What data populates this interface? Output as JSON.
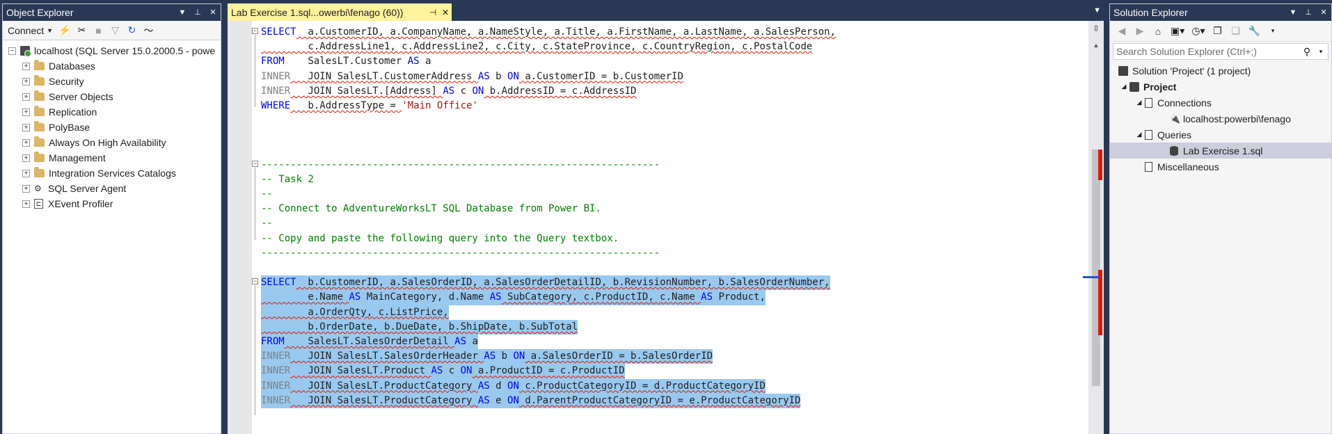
{
  "object_explorer": {
    "title": "Object Explorer",
    "toolbar": {
      "connect_label": "Connect"
    },
    "server_label": "localhost (SQL Server 15.0.2000.5 - powe",
    "nodes": [
      {
        "label": "Databases"
      },
      {
        "label": "Security"
      },
      {
        "label": "Server Objects"
      },
      {
        "label": "Replication"
      },
      {
        "label": "PolyBase"
      },
      {
        "label": "Always On High Availability"
      },
      {
        "label": "Management"
      },
      {
        "label": "Integration Services Catalogs"
      },
      {
        "label": "SQL Server Agent"
      },
      {
        "label": "XEvent Profiler"
      }
    ]
  },
  "editor": {
    "tab_title": "Lab Exercise 1.sql...owerbi\\fenago (60))",
    "code": {
      "l1": {
        "kw": "SELECT",
        "rest": "  a.CustomerID, a.CompanyName, a.NameStyle, a.Title, a.FirstName, a.LastName, a.SalesPerson,"
      },
      "l2": {
        "rest": "        c.AddressLine1, c.AddressLine2, c.City, c.StateProvince, c.CountryRegion, c.PostalCode"
      },
      "l3": {
        "kw": "FROM",
        "rest": "    SalesLT.Customer ",
        "kw2": "AS",
        "rest2": " a"
      },
      "l4": {
        "inner": "INNER",
        "rest": "   JOIN SalesLT.CustomerAddress ",
        "kw2": "AS",
        "rest2": " b ",
        "kw3": "ON",
        "rest3": " a.CustomerID = b.CustomerID"
      },
      "l5": {
        "inner": "INNER",
        "rest": "   JOIN SalesLT.[Address] ",
        "kw2": "AS",
        "rest2": " c ",
        "kw3": "ON",
        "rest3": " b.AddressID = c.AddressID"
      },
      "l6": {
        "kw": "WHERE",
        "rest": "   b.AddressType = ",
        "str": "'Main Office'"
      },
      "c1": "--------------------------------------------------------------------",
      "c2": "-- Task 2",
      "c3": "--",
      "c4": "-- Connect to AdventureWorksLT SQL Database from Power BI.",
      "c5": "--",
      "c6": "-- Copy and paste the following query into the Query textbox.",
      "c7": "--------------------------------------------------------------------",
      "q1": {
        "kw": "SELECT",
        "rest": "  b.CustomerID, a.SalesOrderID, a.SalesOrderDetailID, b.RevisionNumber, b.SalesOrderNumber,"
      },
      "q2": {
        "rest": "        e.Name ",
        "kw2": "AS",
        "rest2": " MainCategory, d.Name ",
        "kw3": "AS",
        "rest3": " SubCategory, c.ProductID, c.Name ",
        "kw4": "AS",
        "rest4": " Product,"
      },
      "q3": {
        "rest": "        a.OrderQty, c.ListPrice,"
      },
      "q4": {
        "rest": "        b.OrderDate, b.DueDate, b.ShipDate, b.SubTotal"
      },
      "q5": {
        "kw": "FROM",
        "rest": "    SalesLT.SalesOrderDetail ",
        "kw2": "AS",
        "rest2": " a"
      },
      "q6": {
        "inner": "INNER",
        "rest": "   JOIN SalesLT.SalesOrderHeader ",
        "kw2": "AS",
        "rest2": " b ",
        "kw3": "ON",
        "rest3": " a.SalesOrderID = b.SalesOrderID"
      },
      "q7": {
        "inner": "INNER",
        "rest": "   JOIN SalesLT.Product ",
        "kw2": "AS",
        "rest2": " c ",
        "kw3": "ON",
        "rest3": " a.ProductID = c.ProductID"
      },
      "q8": {
        "inner": "INNER",
        "rest": "   JOIN SalesLT.ProductCategory ",
        "kw2": "AS",
        "rest2": " d ",
        "kw3": "ON",
        "rest3": " c.ProductCategoryID = d.ProductCategoryID"
      },
      "q9": {
        "inner": "INNER",
        "rest": "   JOIN SalesLT.ProductCategory ",
        "kw2": "AS",
        "rest2": " e ",
        "kw3": "ON",
        "rest3": " d.ParentProductCategoryID = e.ProductCategoryID"
      }
    }
  },
  "solution_explorer": {
    "title": "Solution Explorer",
    "search_placeholder": "Search Solution Explorer (Ctrl+;)",
    "solution_label": "Solution 'Project' (1 project)",
    "project_label": "Project",
    "connections_label": "Connections",
    "connection_item": "localhost:powerbi\\fenago",
    "queries_label": "Queries",
    "query_item": "Lab Exercise 1.sql",
    "misc_label": "Miscellaneous"
  },
  "colors": {
    "chrome": "#293955",
    "active_tab": "#fff29d",
    "keyword": "#0000ff",
    "comment": "#008000",
    "string": "#a31515",
    "selection": "#99c9ef",
    "error_marker": "#e51400"
  }
}
